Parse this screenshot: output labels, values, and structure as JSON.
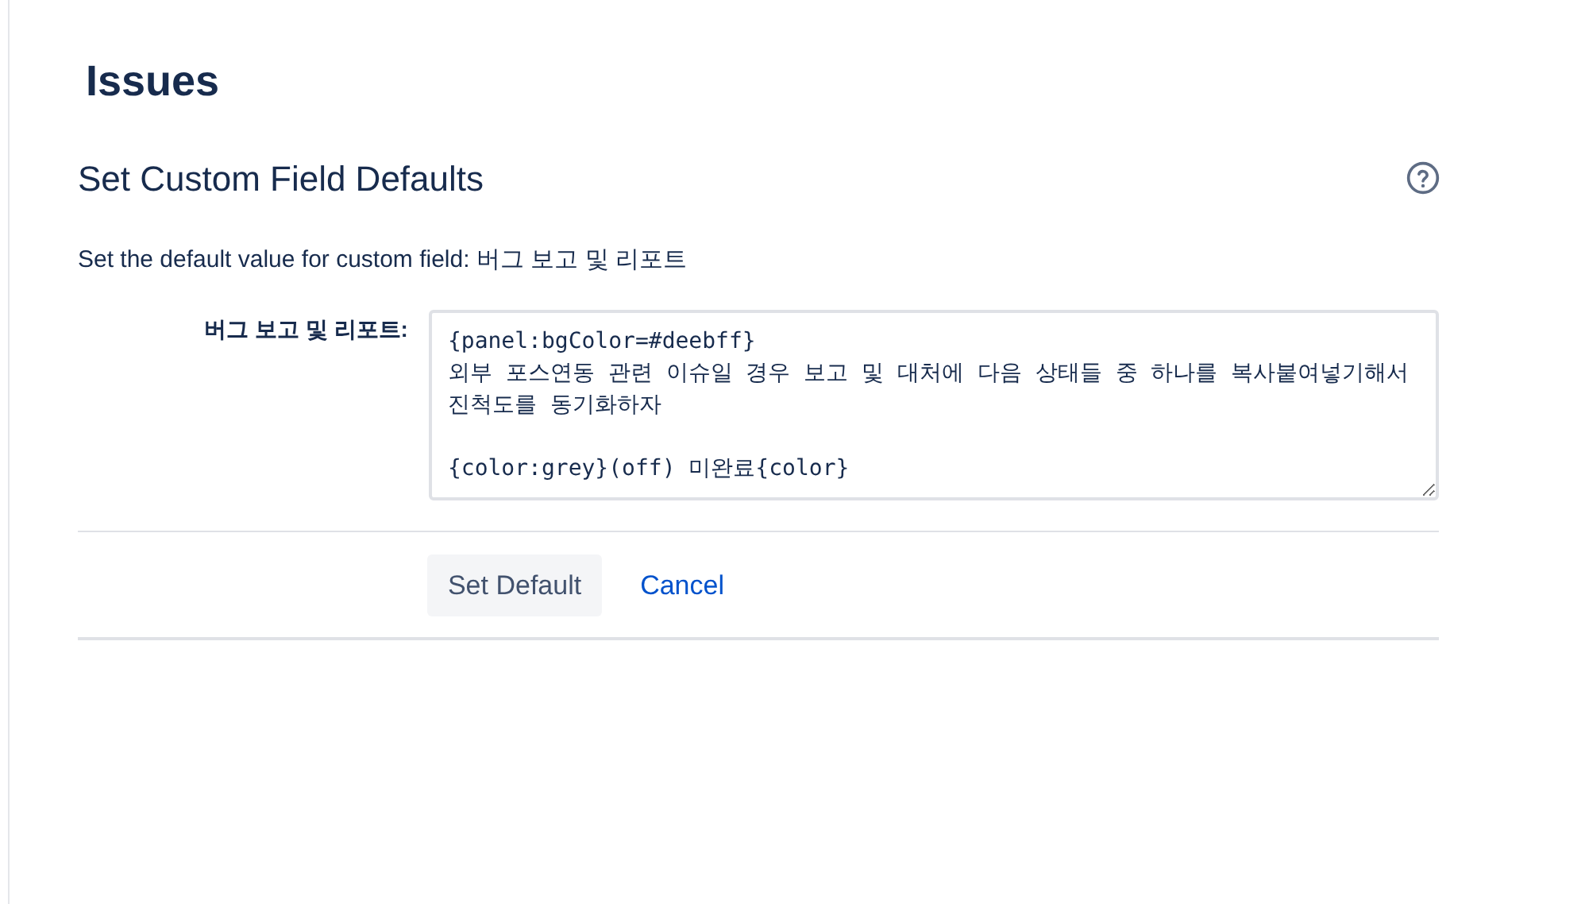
{
  "page_title": "Issues",
  "section": {
    "title": "Set Custom Field Defaults",
    "description": "Set the default value for custom field: 버그 보고 및 리포트"
  },
  "field": {
    "label": "버그 보고 및 리포트:",
    "value": "{panel:bgColor=#deebff}\n외부 포스연동 관련 이슈일 경우 보고 및 대처에 다음 상태들 중 하나를 복사붙여넣기해서 진척도를 동기화하자\n\n{color:grey}(off) 미완료{color}"
  },
  "buttons": [
    {
      "kind": "button",
      "label": "Set Default"
    },
    {
      "kind": "link",
      "label": "Cancel"
    }
  ]
}
